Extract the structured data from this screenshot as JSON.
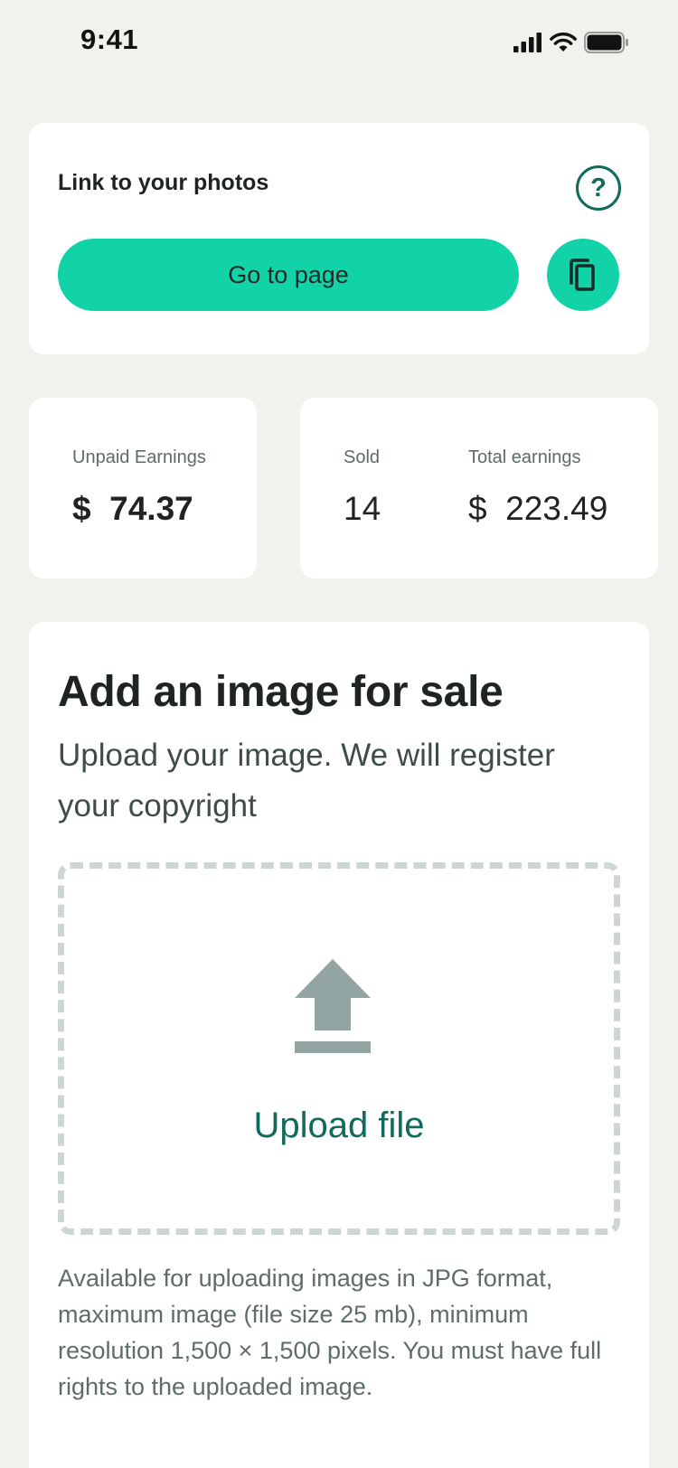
{
  "status_bar": {
    "time": "9:41"
  },
  "link_card": {
    "title": "Link to your photos",
    "help_symbol": "?",
    "go_button_label": "Go to page"
  },
  "unpaid": {
    "label": "Unpaid Earnings",
    "value": "$  74.37"
  },
  "sales": {
    "sold_label": "Sold",
    "sold_value": "14",
    "total_label": "Total earnings",
    "total_value": "$  223.49"
  },
  "upload": {
    "heading": "Add an image for sale",
    "subtitle": "Upload your image. We will register your copyright",
    "button_label": "Upload file",
    "note": "Available for uploading images in JPG format, maximum image (file size 25 mb), minimum resolution 1,500 × 1,500 pixels. You must have full rights to the uploaded image."
  },
  "colors": {
    "accent": "#12d3a8",
    "accent_dark": "#0f6b5a",
    "background": "#f2f2ec",
    "dashed_border": "#cdd6d4",
    "upload_icon": "#92a5a2"
  },
  "icons": [
    "signal-icon",
    "wifi-icon",
    "battery-icon",
    "help-icon",
    "copy-icon",
    "upload-icon"
  ]
}
